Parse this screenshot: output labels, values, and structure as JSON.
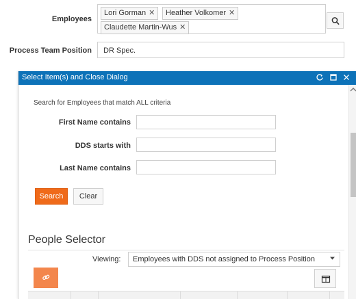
{
  "form": {
    "employees_label": "Employees",
    "employees": [
      {
        "name": "Lori Gorman"
      },
      {
        "name": "Heather Volkomer"
      },
      {
        "name": "Claudette Martin-Wus"
      }
    ],
    "token_remove_glyph": "✕",
    "position_label": "Process Team Position",
    "position_value": "DR Spec."
  },
  "dialog": {
    "title": "Select Item(s) and Close Dialog",
    "criteria_text": "Search for Employees that match ALL criteria",
    "fields": {
      "first_name": {
        "label": "First Name contains",
        "value": ""
      },
      "dds": {
        "label": "DDS starts with",
        "value": ""
      },
      "last_name": {
        "label": "Last Name contains",
        "value": ""
      }
    },
    "search_button": "Search",
    "clear_button": "Clear",
    "people_selector": {
      "heading": "People Selector",
      "viewing_label": "Viewing:",
      "viewing_value": "Employees with DDS not assigned to Process Position"
    }
  },
  "icons": {
    "search": "search-icon",
    "refresh": "refresh-icon",
    "maximize": "maximize-icon",
    "close": "close-icon",
    "link": "link-icon",
    "columns": "columns-icon",
    "dropdown": "chevron-down-icon"
  },
  "colors": {
    "dialog_header": "#0d72b8",
    "primary_button": "#ef6a1a",
    "link_button": "#f3864c"
  }
}
